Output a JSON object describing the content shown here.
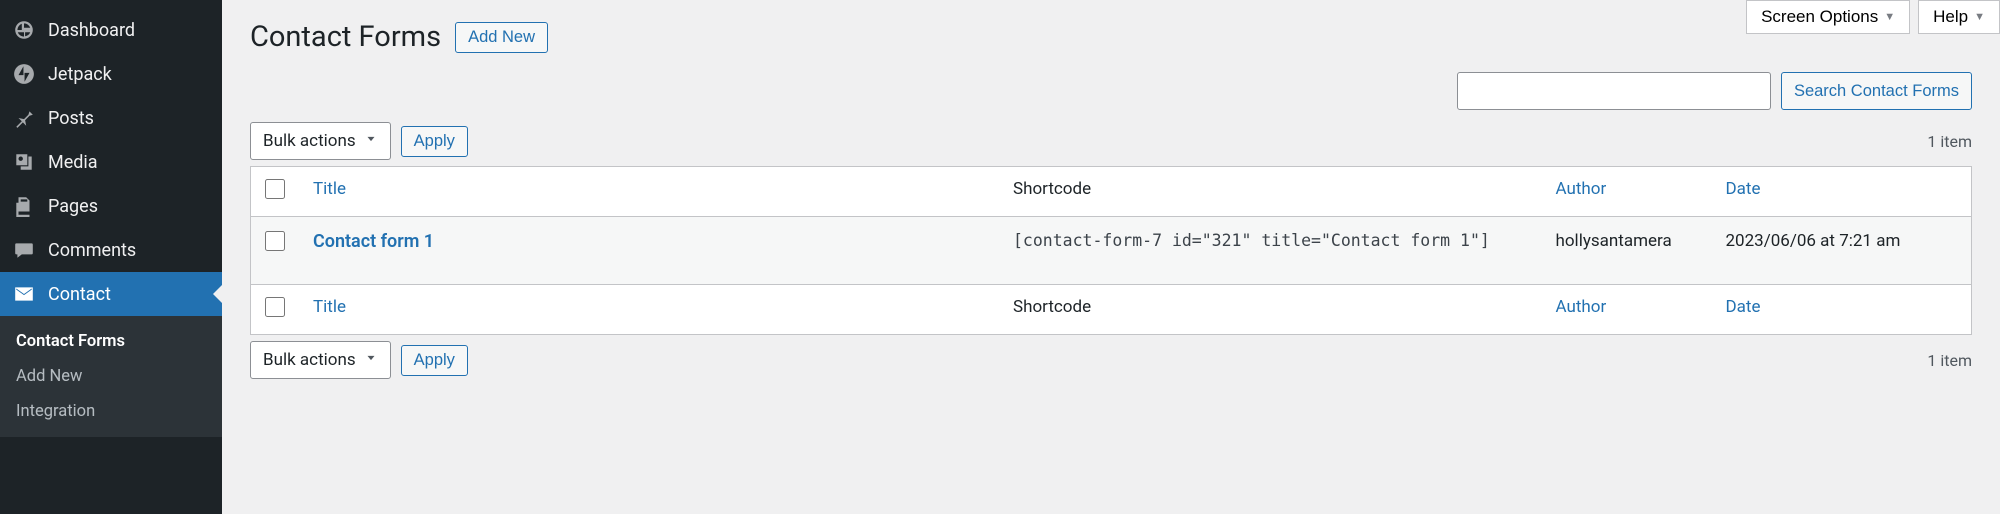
{
  "topControls": {
    "screenOptions": "Screen Options",
    "help": "Help"
  },
  "sidebar": {
    "items": [
      {
        "label": "Dashboard",
        "icon": "dashboard"
      },
      {
        "label": "Jetpack",
        "icon": "jetpack"
      },
      {
        "label": "Posts",
        "icon": "pin"
      },
      {
        "label": "Media",
        "icon": "media"
      },
      {
        "label": "Pages",
        "icon": "pages"
      },
      {
        "label": "Comments",
        "icon": "comments"
      },
      {
        "label": "Contact",
        "icon": "mail",
        "active": true
      }
    ],
    "submenu": [
      {
        "label": "Contact Forms",
        "active": true
      },
      {
        "label": "Add New"
      },
      {
        "label": "Integration"
      }
    ]
  },
  "page": {
    "title": "Contact Forms",
    "addNew": "Add New"
  },
  "search": {
    "value": "",
    "button": "Search Contact Forms"
  },
  "bulk": {
    "label": "Bulk actions",
    "apply": "Apply"
  },
  "itemCount": "1 item",
  "table": {
    "columns": {
      "title": "Title",
      "shortcode": "Shortcode",
      "author": "Author",
      "date": "Date"
    },
    "rows": [
      {
        "title": "Contact form 1",
        "shortcode": "[contact-form-7 id=\"321\" title=\"Contact form 1\"]",
        "author": "hollysantamera",
        "date": "2023/06/06 at 7:21 am"
      }
    ]
  }
}
